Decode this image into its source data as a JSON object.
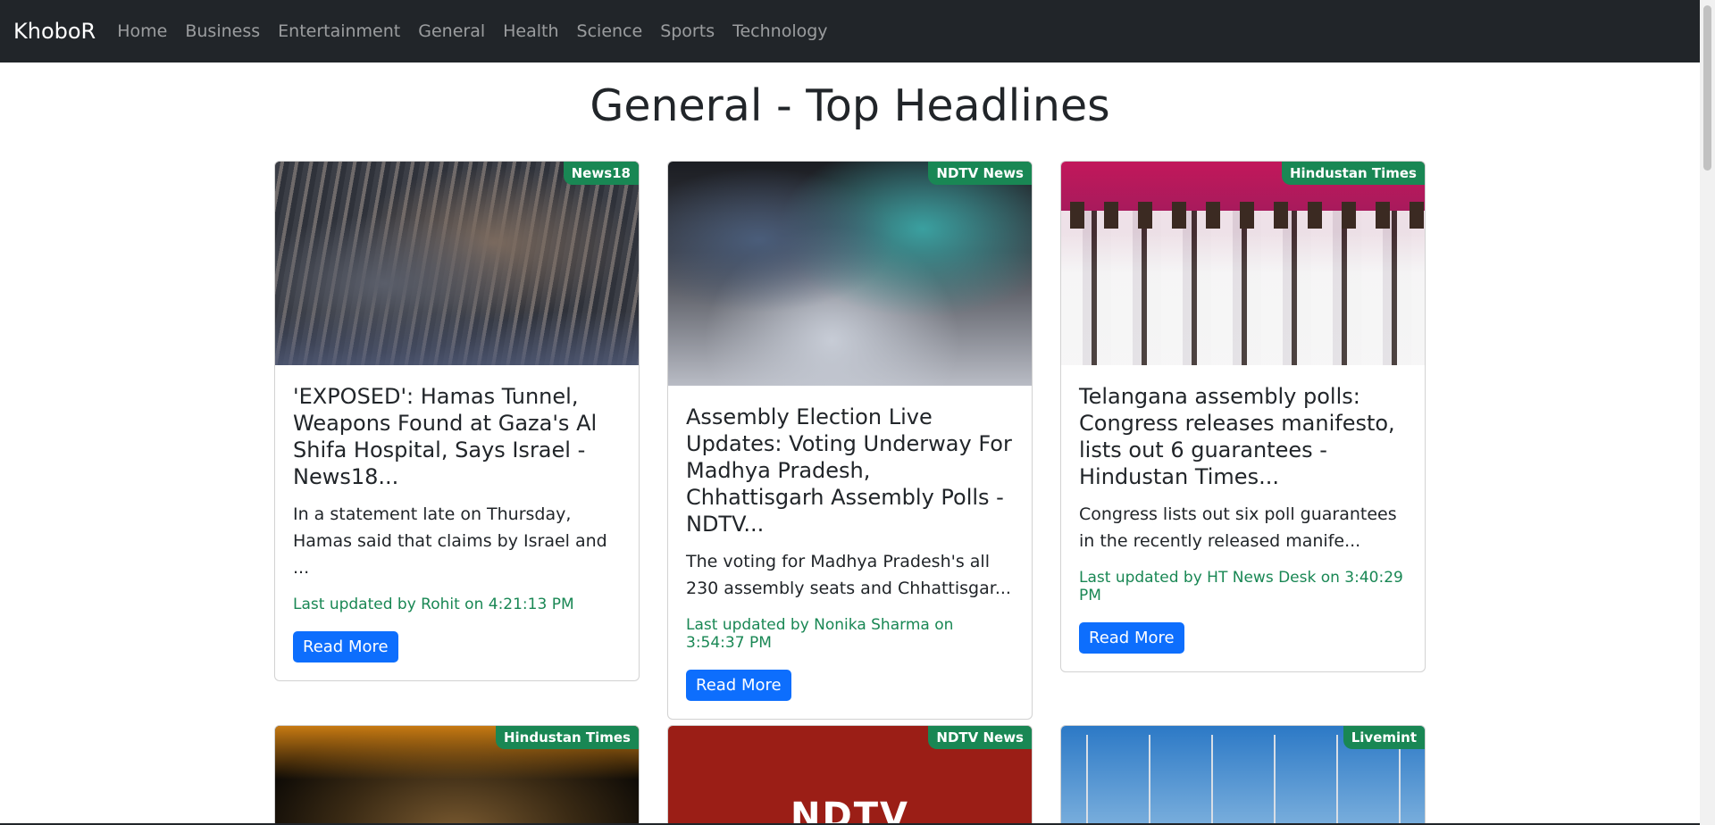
{
  "brand": "KhoboR",
  "nav": [
    "Home",
    "Business",
    "Entertainment",
    "General",
    "Health",
    "Science",
    "Sports",
    "Technology"
  ],
  "page_title": "General - Top Headlines",
  "cards": [
    {
      "source": "News18",
      "title": "'EXPOSED': Hamas Tunnel, Weapons Found at Gaza's Al Shifa Hospital, Says Israel - News18...",
      "description": "In a statement late on Thursday, Hamas said that claims by Israel and ...",
      "meta": "Last updated by Rohit on 4:21:13 PM",
      "button": "Read More"
    },
    {
      "source": "NDTV News",
      "title": "Assembly Election Live Updates: Voting Underway For Madhya Pradesh, Chhattisgarh Assembly Polls - NDTV...",
      "description": "The voting for Madhya Pradesh's all 230 assembly seats and Chhattisgar...",
      "meta": "Last updated by Nonika Sharma on 3:54:37 PM",
      "button": "Read More"
    },
    {
      "source": "Hindustan Times",
      "title": "Telangana assembly polls: Congress releases manifesto, lists out 6 guarantees - Hindustan Times...",
      "description": "Congress lists out six poll guarantees in the recently released manife...",
      "meta": "Last updated by HT News Desk on 3:40:29 PM",
      "button": "Read More"
    },
    {
      "source": "Hindustan Times"
    },
    {
      "source": "NDTV News"
    },
    {
      "source": "Livemint"
    }
  ]
}
